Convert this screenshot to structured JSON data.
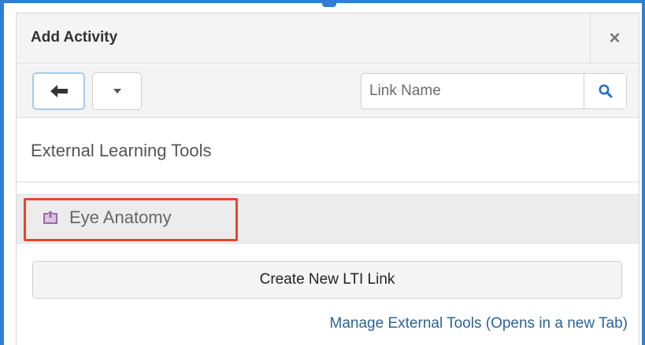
{
  "dialog": {
    "title": "Add Activity",
    "close_label": "×"
  },
  "toolbar": {
    "back_icon": "arrow-left-icon",
    "menu_icon": "caret-down-icon",
    "search": {
      "placeholder": "Link Name",
      "value": "",
      "icon": "search-icon"
    }
  },
  "section": {
    "heading": "External Learning Tools",
    "tools": [
      {
        "label": "Eye Anatomy",
        "icon": "external-tool-icon",
        "highlighted": true
      }
    ]
  },
  "actions": {
    "create_label": "Create New LTI Link",
    "manage_link_label": "Manage External Tools (Opens in a new Tab)"
  },
  "colors": {
    "frame": "#2f7fd6",
    "highlight": "#e8442c",
    "link": "#2a6496",
    "tool_icon": "#9b6aa8",
    "search_icon": "#2a6fbf"
  }
}
